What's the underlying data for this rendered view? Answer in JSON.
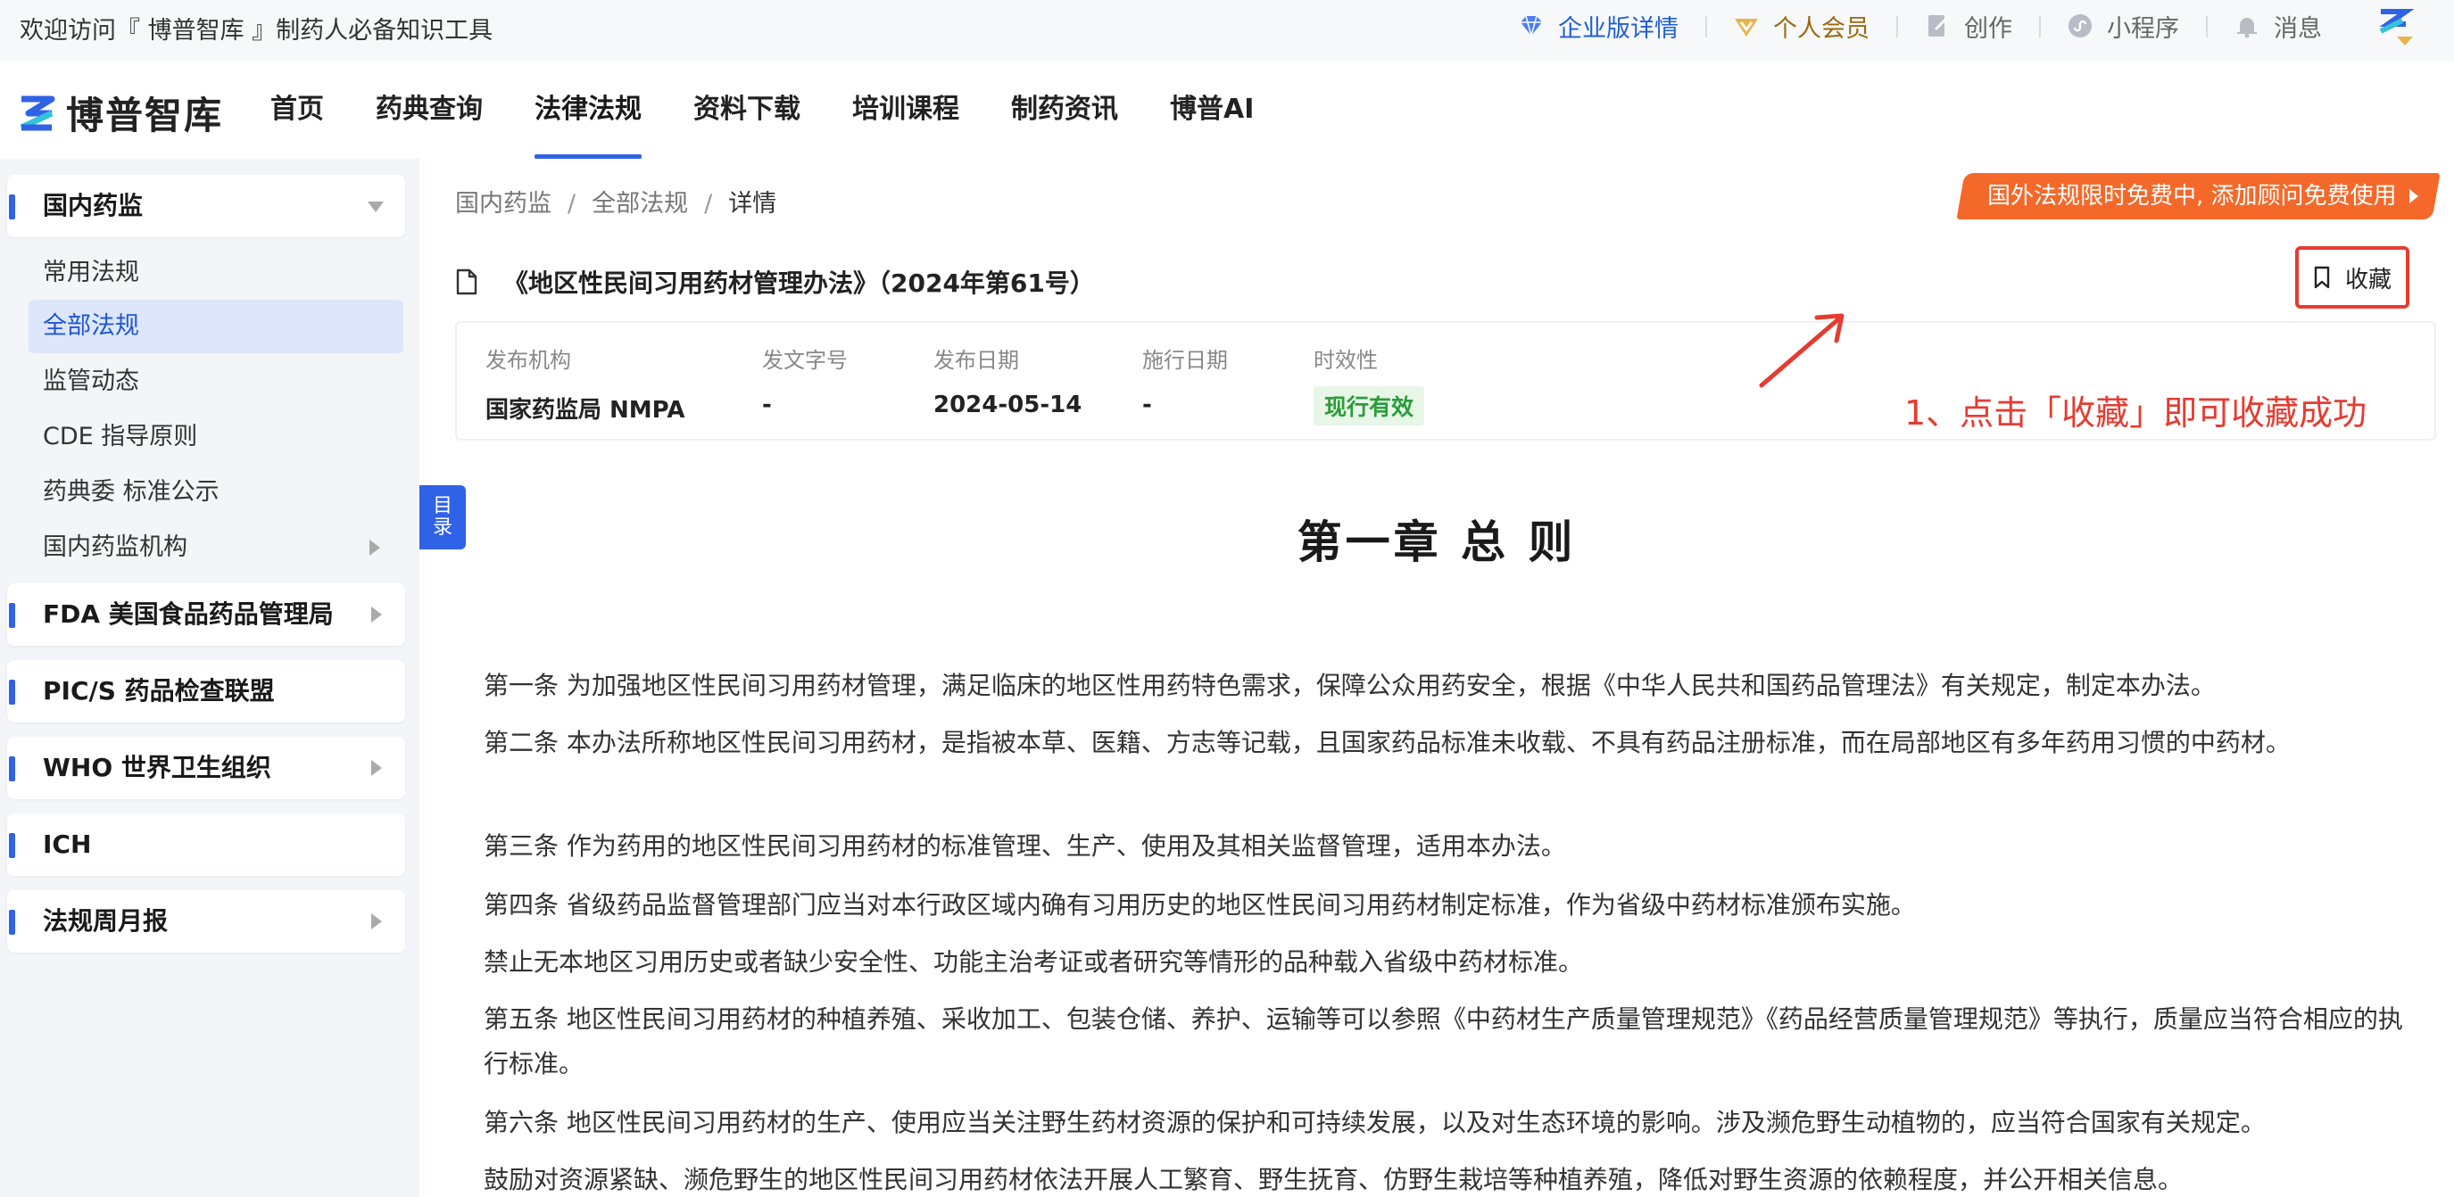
{
  "topbar": {
    "welcome": "欢迎访问『 博普智库 』制药人必备知识工具",
    "enterprise": "企业版详情",
    "vip": "个人会员",
    "create": "创作",
    "miniprogram": "小程序",
    "messages": "消息"
  },
  "nav": {
    "logo": "博普智库",
    "items": [
      "首页",
      "药典查询",
      "法律法规",
      "资料下载",
      "培训课程",
      "制药资讯",
      "博普AI"
    ],
    "active": "法律法规"
  },
  "sidebar": {
    "group_domestic": "国内药监",
    "subs": [
      "常用法规",
      "全部法规",
      "监管动态",
      "CDE 指导原则",
      "药典委 标准公示",
      "国内药监机构"
    ],
    "group_fda": "FDA 美国食品药品管理局",
    "group_pics": "PIC/S 药品检查联盟",
    "group_who": "WHO 世界卫生组织",
    "group_ich": "ICH",
    "group_weekly": "法规周月报"
  },
  "breadcrumb": {
    "level1": "国内药监",
    "level2": "全部法规",
    "current": "详情",
    "sep": "/"
  },
  "promo": "国外法规限时免费中, 添加顾问免费使用",
  "doc": {
    "title": "《地区性民间习用药材管理办法》（2024年第61号）",
    "collect": "收藏",
    "meta": {
      "agency_k": "发布机构",
      "agency_v": "国家药监局 NMPA",
      "docno_k": "发文字号",
      "docno_v": "-",
      "pubdate_k": "发布日期",
      "pubdate_v": "2024-05-14",
      "effdate_k": "施行日期",
      "effdate_v": "-",
      "validity_k": "时效性",
      "validity_v": "现行有效"
    },
    "annotation": "1、点击「收藏」即可收藏成功",
    "toc": [
      "目",
      "录"
    ],
    "chapter": "第一章 总 则",
    "articles": [
      "第一条 为加强地区性民间习用药材管理，满足临床的地区性用药特色需求，保障公众用药安全，根据《中华人民共和国药品管理法》有关规定，制定本办法。",
      "第二条 本办法所称地区性民间习用药材，是指被本草、医籍、方志等记载，且国家药品标准未收载、不具有药品注册标准，而在局部地区有多年药用习惯的中药材。",
      "第三条 作为药用的地区性民间习用药材的标准管理、生产、使用及其相关监督管理，适用本办法。",
      "第四条 省级药品监督管理部门应当对本行政区域内确有习用历史的地区性民间习用药材制定标准，作为省级中药材标准颁布实施。",
      "禁止无本地区习用历史或者缺少安全性、功能主治考证或者研究等情形的品种载入省级中药材标准。",
      "第五条 地区性民间习用药材的种植养殖、采收加工、包装仓储、养护、运输等可以参照《中药材生产质量管理规范》《药品经营质量管理规范》等执行，质量应当符合相应的执行标准。",
      "第六条 地区性民间习用药材的生产、使用应当关注野生药材资源的保护和可持续发展，以及对生态环境的影响。涉及濒危野生动植物的，应当符合国家有关规定。",
      "鼓励对资源紧缺、濒危野生的地区性民间习用药材依法开展人工繁育、野生抚育、仿野生栽培等种植养殖，降低对野生资源的依赖程度，并公开相关信息。"
    ]
  }
}
